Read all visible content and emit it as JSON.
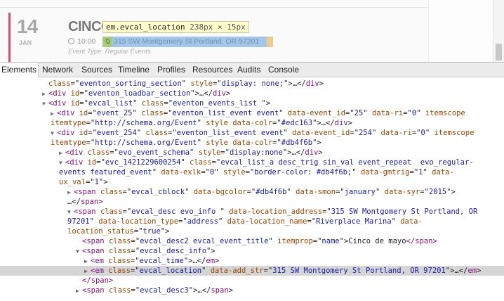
{
  "preview": {
    "day": "14",
    "month": "JAN",
    "event_title": "CINCO",
    "tooltip": {
      "selector": "em.evcal_location",
      "dimensions": "238px × 15px"
    },
    "time": "10:00",
    "location": "315 SW Montgomery St Portland, OR 97201",
    "event_type": "Event Type:  Regular Events",
    "colors": {
      "accent": "#db4f6b",
      "location_highlight": "#a4c6e8"
    }
  },
  "devtools": {
    "tabs": [
      "Elements",
      "Network",
      "Sources",
      "Timeline",
      "Profiles",
      "Resources",
      "Audits",
      "Console"
    ],
    "active_tab": "Elements"
  },
  "dom_tree": [
    {
      "t": "",
      "segs": [
        [
          "an",
          "class"
        ],
        [
          "tx",
          "=\""
        ],
        [
          "av",
          "eventon_sorting_section"
        ],
        [
          "tx",
          "\" "
        ],
        [
          "an",
          "style"
        ],
        [
          "tx",
          "=\""
        ],
        [
          "av",
          "display: none;"
        ],
        [
          "tx",
          "\">…</"
        ],
        [
          "tag",
          "div"
        ],
        [
          "tx",
          ">"
        ]
      ]
    },
    {
      "t": "▶",
      "segs": [
        [
          "tag",
          "<div "
        ],
        [
          "an",
          "id"
        ],
        [
          "tx",
          "=\""
        ],
        [
          "av",
          "eventon_loadbar_section"
        ],
        [
          "tx",
          "\">…</"
        ],
        [
          "tag",
          "div"
        ],
        [
          "tx",
          ">"
        ]
      ]
    },
    {
      "t": "▼",
      "segs": [
        [
          "tag",
          "<div "
        ],
        [
          "an",
          "id"
        ],
        [
          "tx",
          "=\""
        ],
        [
          "av",
          "evcal_list"
        ],
        [
          "tx",
          "\" "
        ],
        [
          "an",
          "class"
        ],
        [
          "tx",
          "=\""
        ],
        [
          "av",
          "eventon_events_list "
        ],
        [
          "tx",
          "\">"
        ]
      ]
    },
    {
      "t": "▶",
      "segs": [
        [
          "tag",
          "<div "
        ],
        [
          "an",
          "id"
        ],
        [
          "tx",
          "=\""
        ],
        [
          "av",
          "event_25"
        ],
        [
          "tx",
          "\" "
        ],
        [
          "an",
          "class"
        ],
        [
          "tx",
          "=\""
        ],
        [
          "av",
          "eventon_list_event event"
        ],
        [
          "tx",
          "\" "
        ],
        [
          "an",
          "data-event_id"
        ],
        [
          "tx",
          "=\""
        ],
        [
          "av",
          "25"
        ],
        [
          "tx",
          "\" "
        ],
        [
          "an",
          "data-ri"
        ],
        [
          "tx",
          "=\""
        ],
        [
          "av",
          "0"
        ],
        [
          "tx",
          "\" "
        ],
        [
          "an",
          "itemscope"
        ]
      ]
    },
    {
      "t": "",
      "segs": [
        [
          "an",
          "itemtype"
        ],
        [
          "tx",
          "=\""
        ],
        [
          "av",
          "http://schema.org/Event"
        ],
        [
          "tx",
          "\" "
        ],
        [
          "an",
          "style"
        ],
        [
          "tx",
          " "
        ],
        [
          "an",
          "data-colr"
        ],
        [
          "tx",
          "=\""
        ],
        [
          "av",
          "#edc163"
        ],
        [
          "tx",
          "\">…</"
        ],
        [
          "tag",
          "div"
        ],
        [
          "tx",
          ">"
        ]
      ]
    },
    {
      "t": "▼",
      "segs": [
        [
          "tag",
          "<div "
        ],
        [
          "an",
          "id"
        ],
        [
          "tx",
          "=\""
        ],
        [
          "av",
          "event_254"
        ],
        [
          "tx",
          "\" "
        ],
        [
          "an",
          "class"
        ],
        [
          "tx",
          "=\""
        ],
        [
          "av",
          "eventon_list_event event"
        ],
        [
          "tx",
          "\" "
        ],
        [
          "an",
          "data-event_id"
        ],
        [
          "tx",
          "=\""
        ],
        [
          "av",
          "254"
        ],
        [
          "tx",
          "\" "
        ],
        [
          "an",
          "data-ri"
        ],
        [
          "tx",
          "=\""
        ],
        [
          "av",
          "0"
        ],
        [
          "tx",
          "\" "
        ],
        [
          "an",
          "itemscope"
        ]
      ]
    },
    {
      "t": "",
      "segs": [
        [
          "an",
          "itemtype"
        ],
        [
          "tx",
          "=\""
        ],
        [
          "av",
          "http://schema.org/Event"
        ],
        [
          "tx",
          "\" "
        ],
        [
          "an",
          "style"
        ],
        [
          "tx",
          " "
        ],
        [
          "an",
          "data-colr"
        ],
        [
          "tx",
          "=\""
        ],
        [
          "av",
          "#db4f6b"
        ],
        [
          "tx",
          "\">"
        ]
      ]
    },
    {
      "t": "▶",
      "segs": [
        [
          "tag",
          "<div "
        ],
        [
          "an",
          "class"
        ],
        [
          "tx",
          "=\""
        ],
        [
          "av",
          "evo_event_schema"
        ],
        [
          "tx",
          "\" "
        ],
        [
          "an",
          "style"
        ],
        [
          "tx",
          "=\""
        ],
        [
          "av",
          "display:none"
        ],
        [
          "tx",
          "\">…</"
        ],
        [
          "tag",
          "div"
        ],
        [
          "tx",
          ">"
        ]
      ]
    },
    {
      "t": "▼",
      "segs": [
        [
          "tag",
          "<div "
        ],
        [
          "an",
          "id"
        ],
        [
          "tx",
          "=\""
        ],
        [
          "av",
          "evc_1421229600254"
        ],
        [
          "tx",
          "\" "
        ],
        [
          "an",
          "class"
        ],
        [
          "tx",
          "=\""
        ],
        [
          "av",
          "evcal_list_a desc_trig sin_val event_repeat  evo_regular-"
        ]
      ]
    },
    {
      "t": "",
      "segs": [
        [
          "av",
          "events featured_event"
        ],
        [
          "tx",
          "\" "
        ],
        [
          "an",
          "data-exlk"
        ],
        [
          "tx",
          "=\""
        ],
        [
          "av",
          "0"
        ],
        [
          "tx",
          "\" "
        ],
        [
          "an",
          "style"
        ],
        [
          "tx",
          "=\""
        ],
        [
          "av",
          "border-color: #db4f6b;"
        ],
        [
          "tx",
          "\" "
        ],
        [
          "an",
          "data-gmtrig"
        ],
        [
          "tx",
          "=\""
        ],
        [
          "av",
          "1"
        ],
        [
          "tx",
          "\" "
        ],
        [
          "an",
          "data-"
        ]
      ]
    },
    {
      "t": "",
      "segs": [
        [
          "an",
          "ux_val"
        ],
        [
          "tx",
          "=\""
        ],
        [
          "av",
          "1"
        ],
        [
          "tx",
          "\">"
        ]
      ]
    },
    {
      "t": "▶",
      "segs": [
        [
          "tag",
          "<span "
        ],
        [
          "an",
          "class"
        ],
        [
          "tx",
          "=\""
        ],
        [
          "av",
          "evcal_cblock"
        ],
        [
          "tx",
          "\" "
        ],
        [
          "an",
          "data-bgcolor"
        ],
        [
          "tx",
          "=\""
        ],
        [
          "av",
          "#db4f6b"
        ],
        [
          "tx",
          "\" "
        ],
        [
          "an",
          "data-smon"
        ],
        [
          "tx",
          "=\""
        ],
        [
          "av",
          "january"
        ],
        [
          "tx",
          "\" "
        ],
        [
          "an",
          "data-syr"
        ],
        [
          "tx",
          "=\""
        ],
        [
          "av",
          "2015"
        ],
        [
          "tx",
          "\">"
        ]
      ]
    },
    {
      "t": "",
      "segs": [
        [
          "tx",
          "…</"
        ],
        [
          "tag",
          "span"
        ],
        [
          "tx",
          ">"
        ]
      ]
    },
    {
      "t": "▼",
      "segs": [
        [
          "tag",
          "<span "
        ],
        [
          "an",
          "class"
        ],
        [
          "tx",
          "=\""
        ],
        [
          "av",
          "evcal_desc evo_info "
        ],
        [
          "tx",
          "\" "
        ],
        [
          "an",
          "data-location_address"
        ],
        [
          "tx",
          "=\""
        ],
        [
          "av",
          "315 SW Montgomery St Portland, OR"
        ]
      ]
    },
    {
      "t": "",
      "segs": [
        [
          "av",
          "97201"
        ],
        [
          "tx",
          "\" "
        ],
        [
          "an",
          "data-location_type"
        ],
        [
          "tx",
          "=\""
        ],
        [
          "av",
          "address"
        ],
        [
          "tx",
          "\" "
        ],
        [
          "an",
          "data-location_name"
        ],
        [
          "tx",
          "=\""
        ],
        [
          "av",
          "Riverplace Marina"
        ],
        [
          "tx",
          "\" "
        ],
        [
          "an",
          "data-"
        ]
      ]
    },
    {
      "t": "",
      "segs": [
        [
          "an",
          "location_status"
        ],
        [
          "tx",
          "=\""
        ],
        [
          "av",
          "true"
        ],
        [
          "tx",
          "\">"
        ]
      ]
    },
    {
      "t": "",
      "segs": [
        [
          "tag",
          "<span "
        ],
        [
          "an",
          "class"
        ],
        [
          "tx",
          "=\""
        ],
        [
          "av",
          "evcal_desc2 evcal_event_title"
        ],
        [
          "tx",
          "\" "
        ],
        [
          "an",
          "itemprop"
        ],
        [
          "tx",
          "=\""
        ],
        [
          "av",
          "name"
        ],
        [
          "tx",
          "\">"
        ],
        [
          "el",
          "Cinco de mayo"
        ],
        [
          "tag",
          "</span>"
        ]
      ]
    },
    {
      "t": "▼",
      "segs": [
        [
          "tag",
          "<span "
        ],
        [
          "an",
          "class"
        ],
        [
          "tx",
          "=\""
        ],
        [
          "av",
          "evcal_desc_info"
        ],
        [
          "tx",
          "\">"
        ]
      ]
    },
    {
      "t": "▶",
      "segs": [
        [
          "tag",
          "<em "
        ],
        [
          "an",
          "class"
        ],
        [
          "tx",
          "=\""
        ],
        [
          "av",
          "evcal_time"
        ],
        [
          "tx",
          "\">…</"
        ],
        [
          "tag",
          "em"
        ],
        [
          "tx",
          ">"
        ]
      ]
    },
    {
      "t": "▶",
      "segs": [
        [
          "tag",
          "<em "
        ],
        [
          "an",
          "class"
        ],
        [
          "tx",
          "=\""
        ],
        [
          "av",
          "evcal_location"
        ],
        [
          "tx",
          "\" "
        ],
        [
          "an",
          "data-add_str"
        ],
        [
          "tx",
          "=\""
        ],
        [
          "av",
          "315 SW Montgomery St Portland, OR 97201"
        ],
        [
          "tx",
          "\">…</"
        ],
        [
          "tag",
          "em"
        ],
        [
          "tx",
          ">"
        ]
      ]
    },
    {
      "t": "",
      "segs": [
        [
          "tag",
          "</span>"
        ]
      ]
    },
    {
      "t": "▶",
      "segs": [
        [
          "tag",
          "<span "
        ],
        [
          "an",
          "class"
        ],
        [
          "tx",
          "=\""
        ],
        [
          "av",
          "evcal_desc3"
        ],
        [
          "tx",
          "\">…</"
        ],
        [
          "tag",
          "span"
        ],
        [
          "tx",
          ">"
        ]
      ]
    }
  ]
}
